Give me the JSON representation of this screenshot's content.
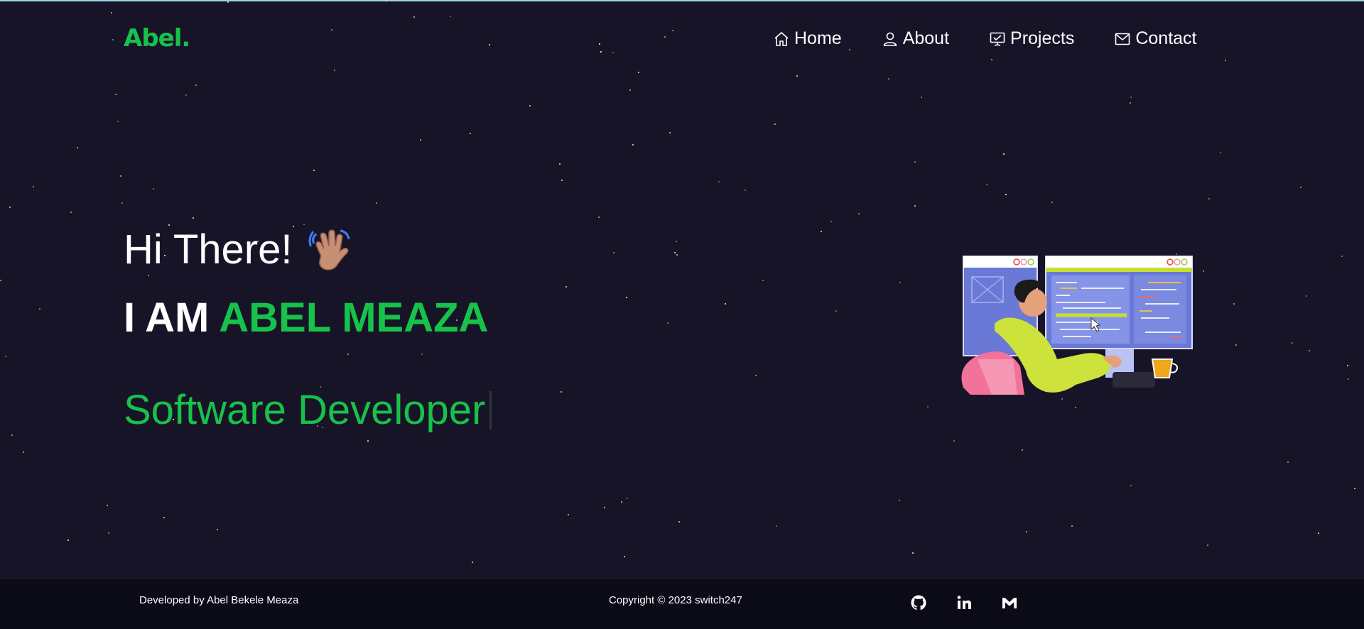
{
  "nav": {
    "logo": "Abel.",
    "items": [
      {
        "label": "Home",
        "icon": "home-icon"
      },
      {
        "label": "About",
        "icon": "user-icon"
      },
      {
        "label": "Projects",
        "icon": "projects-icon"
      },
      {
        "label": "Contact",
        "icon": "mail-icon"
      }
    ]
  },
  "hero": {
    "greeting": "Hi There!",
    "iam_prefix": "I AM",
    "name": "ABEL MEAZA",
    "role": "Software Developer"
  },
  "footer": {
    "developed_by": "Developed by Abel Bekele Meaza",
    "copyright": "Copyright © 2023 switch247",
    "socials": [
      "github-icon",
      "linkedin-icon",
      "gmail-icon"
    ]
  },
  "colors": {
    "background": "#181428",
    "accent": "#17c24a",
    "footer_bg": "#0b0a17"
  }
}
